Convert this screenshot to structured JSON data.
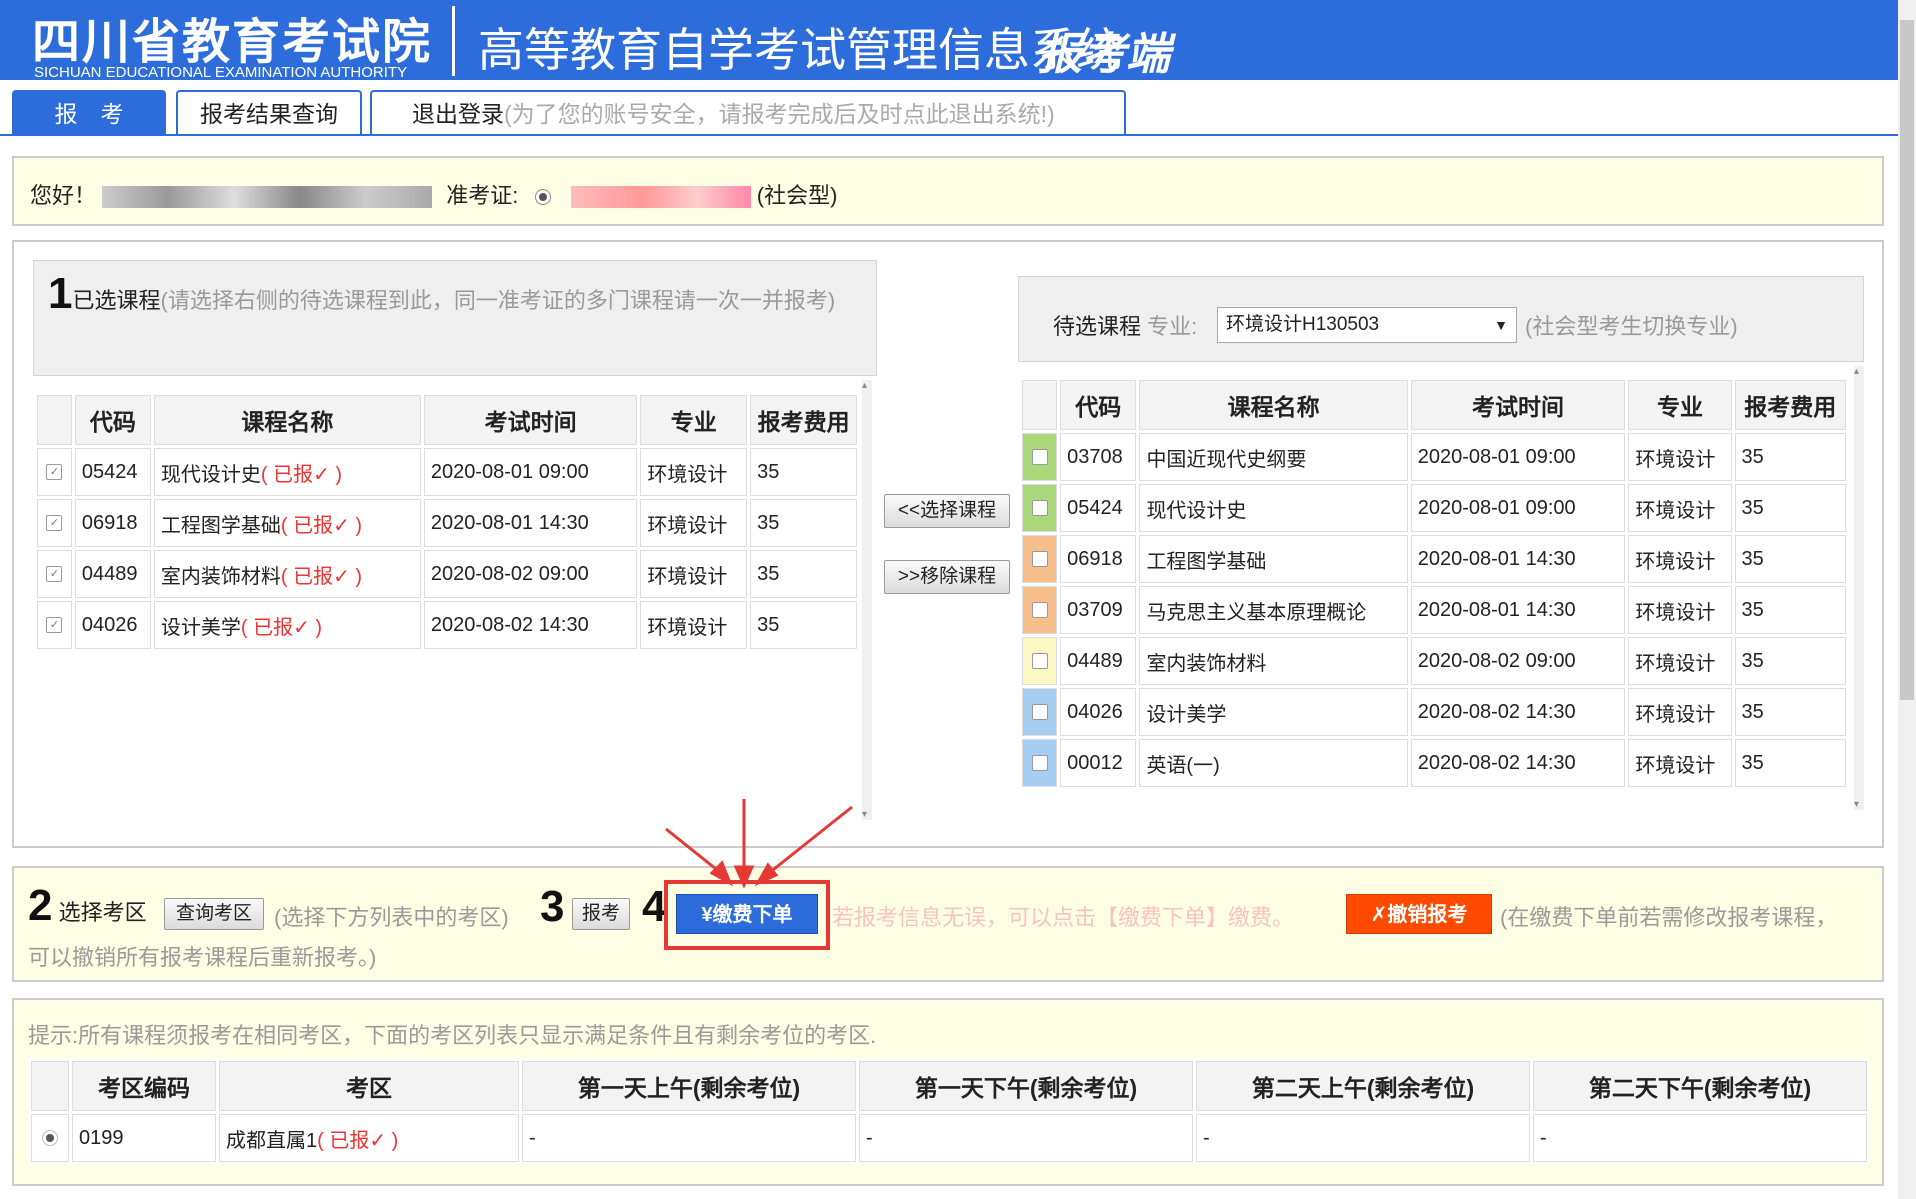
{
  "header": {
    "org_cn": "四川省教育考试院",
    "org_en": "SICHUAN EDUCATIONAL EXAMINATION AUTHORITY",
    "system": "高等教育自学考试管理信息系统",
    "portal": "报考端"
  },
  "tabs": {
    "register": "报　考",
    "results": "报考结果查询",
    "logout": "退出登录",
    "logout_hint": "(为了您的账号安全，请报考完成后及时点此退出系统!)"
  },
  "greeting": {
    "hello": "您好！",
    "ticket_label": "准考证:",
    "type": "(社会型)"
  },
  "selected": {
    "step": "1",
    "title": "已选课程",
    "hint": "(请选择右侧的待选课程到此，同一准考证的多门课程请一次一并报考)",
    "headers": [
      "代码",
      "课程名称",
      "考试时间",
      "专业",
      "报考费用"
    ],
    "tag": "( 已报✓ )",
    "rows": [
      {
        "code": "05424",
        "name": "现代设计史",
        "time": "2020-08-01 09:00",
        "major": "环境设计",
        "fee": "35"
      },
      {
        "code": "06918",
        "name": "工程图学基础",
        "time": "2020-08-01 14:30",
        "major": "环境设计",
        "fee": "35"
      },
      {
        "code": "04489",
        "name": "室内装饰材料",
        "time": "2020-08-02 09:00",
        "major": "环境设计",
        "fee": "35"
      },
      {
        "code": "04026",
        "name": "设计美学",
        "time": "2020-08-02 14:30",
        "major": "环境设计",
        "fee": "35"
      }
    ]
  },
  "buttons": {
    "select": "<<选择课程",
    "remove": ">>移除课程"
  },
  "pending": {
    "title": "待选课程",
    "major_label": "专业:",
    "major_value": "环境设计H130503",
    "hint": "(社会型考生切换专业)",
    "headers": [
      "代码",
      "课程名称",
      "考试时间",
      "专业",
      "报考费用"
    ],
    "rows": [
      {
        "code": "03708",
        "name": "中国近现代史纲要",
        "time": "2020-08-01 09:00",
        "major": "环境设计",
        "fee": "35",
        "color": "#a8d878"
      },
      {
        "code": "05424",
        "name": "现代设计史",
        "time": "2020-08-01 09:00",
        "major": "环境设计",
        "fee": "35",
        "color": "#a8d878"
      },
      {
        "code": "06918",
        "name": "工程图学基础",
        "time": "2020-08-01 14:30",
        "major": "环境设计",
        "fee": "35",
        "color": "#f7bf8c"
      },
      {
        "code": "03709",
        "name": "马克思主义基本原理概论",
        "time": "2020-08-01 14:30",
        "major": "环境设计",
        "fee": "35",
        "color": "#f7bf8c"
      },
      {
        "code": "04489",
        "name": "室内装饰材料",
        "time": "2020-08-02 09:00",
        "major": "环境设计",
        "fee": "35",
        "color": "#fbf8c4"
      },
      {
        "code": "04026",
        "name": "设计美学",
        "time": "2020-08-02 14:30",
        "major": "环境设计",
        "fee": "35",
        "color": "#a6cdf2"
      },
      {
        "code": "00012",
        "name": "英语(一)",
        "time": "2020-08-02 14:30",
        "major": "环境设计",
        "fee": "35",
        "color": "#a6cdf2"
      }
    ]
  },
  "steps": {
    "s2": "2",
    "s2_label": "选择考区",
    "query_btn": "查询考区",
    "s2_hint": "(选择下方列表中的考区)",
    "s3": "3",
    "register_btn": "报考",
    "s4": "4",
    "pay_btn": "¥缴费下单",
    "pay_hint": "若报考信息无误，可以点击【缴费下单】缴费。",
    "cancel_btn": "✗撤销报考",
    "cancel_hint_1": "(在缴费下单前若需修改报考课程，",
    "cancel_hint_2": "可以撤销所有报考课程后重新报考。)"
  },
  "exam_area": {
    "notice": "提示:所有课程须报考在相同考区，下面的考区列表只显示满足条件且有剩余考位的考区.",
    "headers": [
      "考区编码",
      "考区",
      "第一天上午(剩余考位)",
      "第一天下午(剩余考位)",
      "第二天上午(剩余考位)",
      "第二天下午(剩余考位)"
    ],
    "rows": [
      {
        "code": "0199",
        "name": "成都直属1",
        "tag": "( 已报✓ )",
        "d1am": "-",
        "d1pm": "-",
        "d2am": "-",
        "d2pm": "-"
      }
    ]
  },
  "colors": {
    "brand": "#2d6ddb",
    "highlight": "#e53935",
    "cancel": "#ff4a00"
  }
}
